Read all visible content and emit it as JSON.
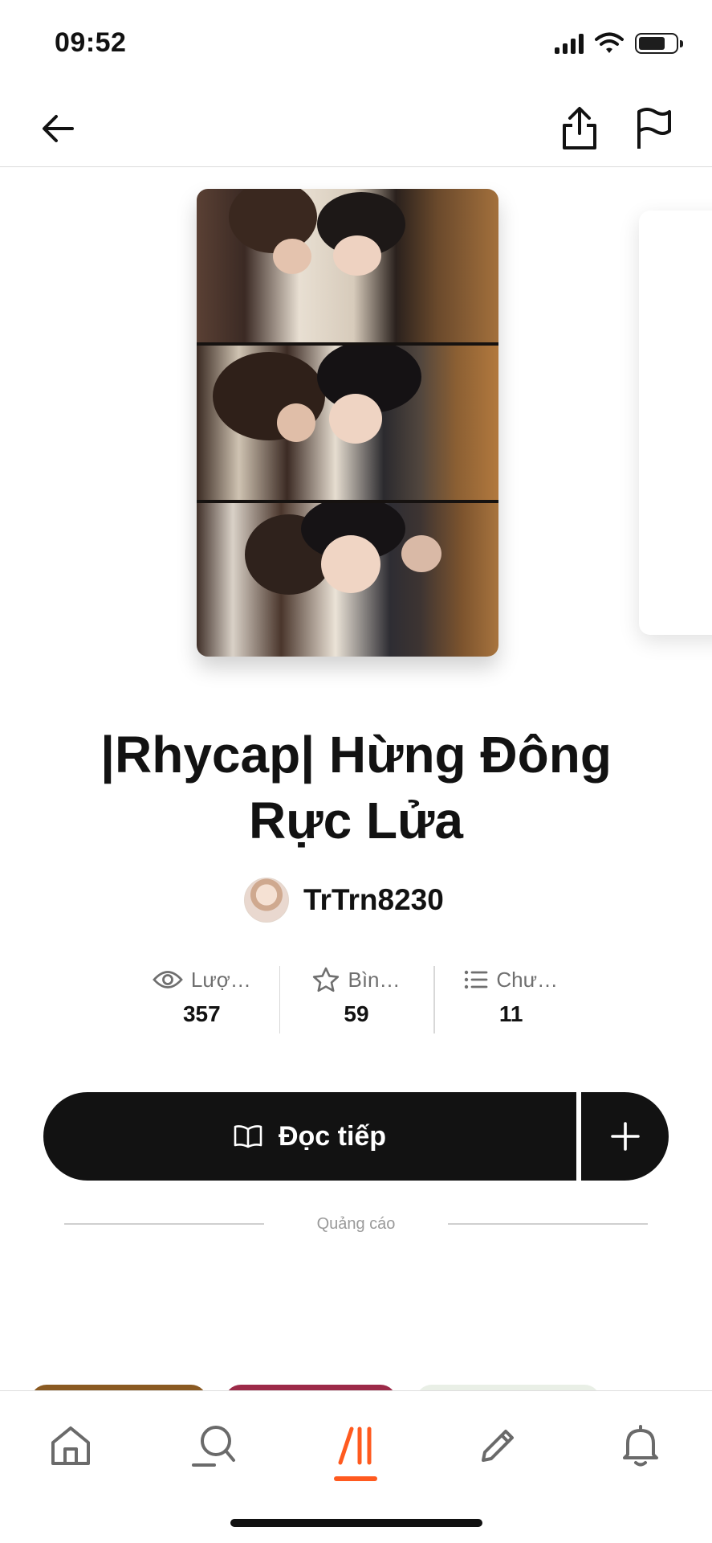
{
  "status_bar": {
    "time": "09:52"
  },
  "header": {
    "back_icon": "arrow-left-icon",
    "share_icon": "share-upload-icon",
    "flag_icon": "flag-icon"
  },
  "story": {
    "title": "|Rhycap| Hừng Đông Rực Lửa",
    "author": "TrTrn8230"
  },
  "stats": [
    {
      "icon": "eye-icon",
      "label": "Lượ…",
      "value": "357"
    },
    {
      "icon": "star-icon",
      "label": "Bìn…",
      "value": "59"
    },
    {
      "icon": "list-icon",
      "label": "Chư…",
      "value": "11"
    }
  ],
  "actions": {
    "read_label": "Đọc tiếp",
    "read_icon": "book-open-icon",
    "add_icon": "plus-icon"
  },
  "ad": {
    "label": "Quảng cáo"
  },
  "bottom_nav": [
    {
      "icon": "home-icon",
      "active": false
    },
    {
      "icon": "search-icon",
      "active": false
    },
    {
      "icon": "reading-list-icon",
      "active": true
    },
    {
      "icon": "pencil-icon",
      "active": false
    },
    {
      "icon": "bell-icon",
      "active": false
    }
  ],
  "colors": {
    "accent": "#ff5a1f",
    "button_bg": "#121212",
    "divider": "#dcdcdc"
  }
}
